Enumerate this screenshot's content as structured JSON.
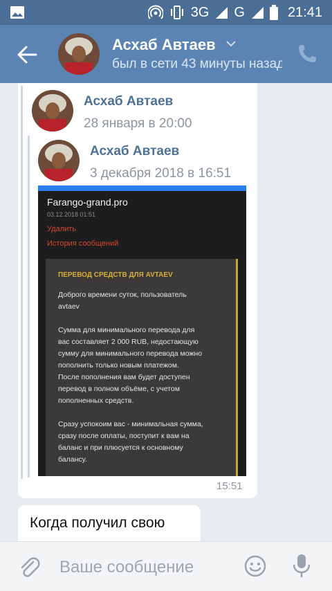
{
  "statusbar": {
    "network_3g": "3G",
    "network_g": "G",
    "time": "21:41"
  },
  "header": {
    "contact_name": "Асхаб Автаев",
    "status": "был в сети 43 минуты назад"
  },
  "messages": [
    {
      "forward_outer": {
        "author": "Асхаб Автаев",
        "date": "28 января в 20:00"
      },
      "forward_inner": {
        "author": "Асхаб Автаев",
        "date": "3 декабря 2018 в 16:51"
      },
      "attachment": {
        "site": "Farango-grand.pro",
        "date": "03.12.2018 01:51",
        "link_delete": "Удалить",
        "link_history": "История сообщений",
        "panel_title": "ПЕРЕВОД СРЕДСТВ ДЛЯ AVTAEV",
        "panel_text": "Доброго времени суток, пользователь\navtaev\n\nСумма для минимального перевода для\nвас составляет 2 000 RUB, недостающую\nсумму для минимального перевода можно\nпополнить только новым платежом.\nПосле пополнения вам будет доступен\nперевод в полном объёме, с учетом\nпополненных средств.\n\nСразу успокоим вас - минимальная сумма,\nсразу после оплаты, поступит к вам на\nбаланс и при плюсуется к основному\nбалансу."
      },
      "time": "15:51"
    },
    {
      "text": "Когда получил свою"
    }
  ],
  "input": {
    "placeholder": "Ваше сообщение"
  },
  "icons": [
    "image-icon",
    "hotspot-icon",
    "vibrate-icon",
    "signal-icon",
    "battery-icon",
    "back-arrow-icon",
    "chevron-down-icon",
    "phone-icon",
    "paperclip-icon",
    "smile-icon",
    "microphone-icon"
  ],
  "colors": {
    "header": "#5b84b4",
    "statusbar": "#4a6e96",
    "link_name": "#4d7198",
    "background": "#e6ebf0"
  }
}
